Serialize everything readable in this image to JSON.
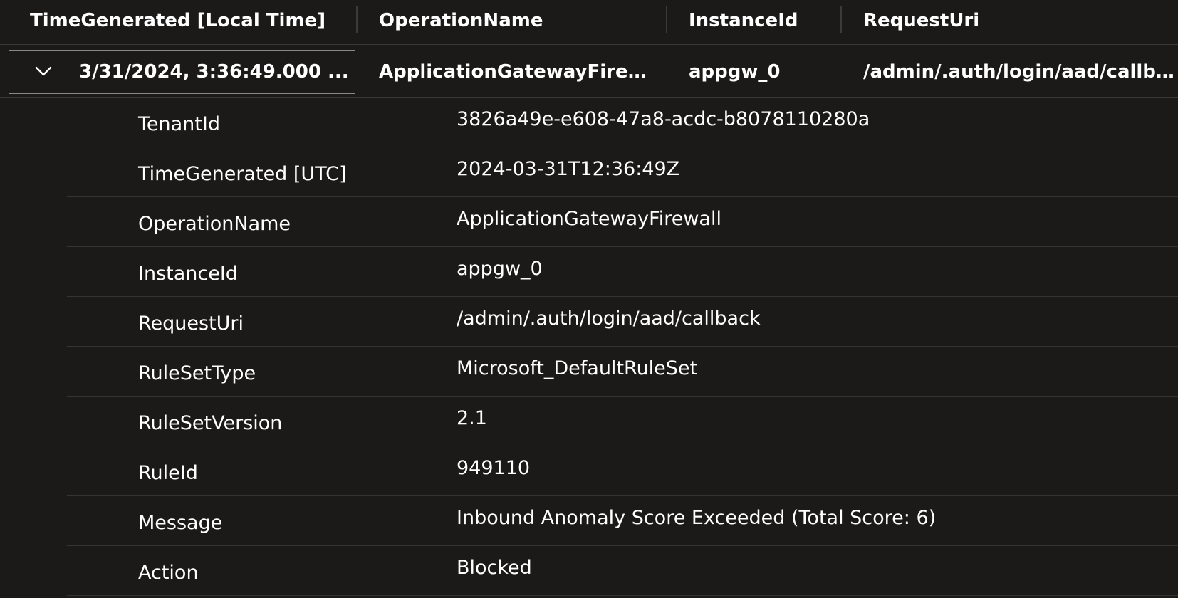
{
  "columns": [
    {
      "label": "TimeGenerated [Local Time]"
    },
    {
      "label": "OperationName"
    },
    {
      "label": "InstanceId"
    },
    {
      "label": "RequestUri"
    }
  ],
  "row": {
    "time": "3/31/2024, 3:36:49.000 ...",
    "operation": "ApplicationGatewayFirew...",
    "instance": "appgw_0",
    "uri": "/admin/.auth/login/aad/callba..."
  },
  "icons": {
    "expand": "chevron-down-icon"
  },
  "details": [
    {
      "key": "TenantId",
      "value": "3826a49e-e608-47a8-acdc-b8078110280a"
    },
    {
      "key": "TimeGenerated [UTC]",
      "value": "2024-03-31T12:36:49Z"
    },
    {
      "key": "OperationName",
      "value": "ApplicationGatewayFirewall"
    },
    {
      "key": "InstanceId",
      "value": "appgw_0"
    },
    {
      "key": "RequestUri",
      "value": "/admin/.auth/login/aad/callback"
    },
    {
      "key": "RuleSetType",
      "value": "Microsoft_DefaultRuleSet"
    },
    {
      "key": "RuleSetVersion",
      "value": "2.1"
    },
    {
      "key": "RuleId",
      "value": "949110"
    },
    {
      "key": "Message",
      "value": "Inbound Anomaly Score Exceeded (Total Score: 6)"
    },
    {
      "key": "Action",
      "value": "Blocked"
    }
  ]
}
